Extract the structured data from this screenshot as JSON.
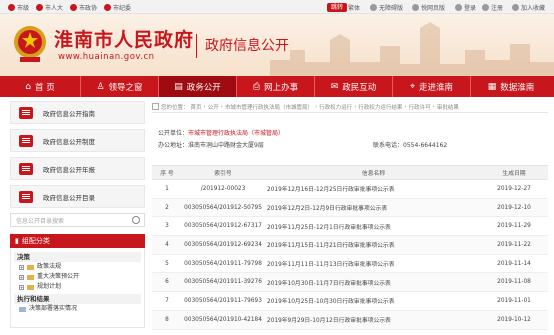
{
  "topbar": {
    "items": [
      "市级",
      "市人大",
      "市政协",
      "市纪委"
    ],
    "jump_label": "跳转",
    "links": [
      "繁体",
      "无障碍版",
      "悦网页版",
      "登录",
      "注册",
      "加入收藏"
    ]
  },
  "header": {
    "site_name": "淮南市人民政府",
    "site_url": "www.huainan.gov.cn",
    "section_title": "政府信息公开"
  },
  "nav": {
    "items": [
      {
        "icon": "home-icon",
        "label": "首 页",
        "glyph": "⌂"
      },
      {
        "icon": "leader-icon",
        "label": "领导之窗",
        "glyph": "♙"
      },
      {
        "icon": "policy-icon",
        "label": "政务公开",
        "glyph": "▤"
      },
      {
        "icon": "online-service-icon",
        "label": "网上办事",
        "glyph": "⎙"
      },
      {
        "icon": "interaction-icon",
        "label": "政民互动",
        "glyph": "✉"
      },
      {
        "icon": "city-icon",
        "label": "走进淮南",
        "glyph": "⌖"
      },
      {
        "icon": "data-icon",
        "label": "数据淮南",
        "glyph": "▦"
      }
    ],
    "active_index": 2
  },
  "sidebar": {
    "buttons": [
      "政府信息公开指南",
      "政府信息公开制度",
      "政府信息公开年报",
      "政府信息公开目录"
    ],
    "search_placeholder": "信息公开目录搜索",
    "tree_title": "组配分类",
    "categories": [
      {
        "label": "决策",
        "items": [
          "政策法规",
          "重大决策预公开",
          "规划计划"
        ]
      },
      {
        "label": "执行和结果",
        "items": [
          "决策部署落实情况"
        ]
      }
    ]
  },
  "breadcrumb": {
    "items": [
      "您的位置：",
      "首页",
      "公开",
      "市城市管理行政执法局（市城管局）",
      "行政权力运行",
      "行政权力运行结果",
      "行政许可",
      "审批结果"
    ]
  },
  "publisher": {
    "unit_label": "公开单位：",
    "unit_value": "市城市管理行政执法局（市城管局）",
    "address_label": "办公地址：",
    "address_value": "淮南市洞山中路财金大厦9层",
    "phone_label": "联系电话：",
    "phone_value": "0554-6644162"
  },
  "table": {
    "headers": [
      "序 号",
      "索引号",
      "信息名称",
      "生成日期"
    ],
    "rows": [
      [
        "1",
        "/201912-00023",
        "2019年12月16日-12月25日行政审批事项公示表",
        "2019-12-27"
      ],
      [
        "2",
        "003050564/201912-50795",
        "2019年12月2日-12月9日行政审批事项公示表",
        "2019-12-10"
      ],
      [
        "3",
        "003050564/201912-67317",
        "2019年11月25日-12月1日行政审批事项公示表",
        "2019-11-29"
      ],
      [
        "4",
        "003050564/201912-69234",
        "2019年11月15日-11月21日行政审批事项公示表",
        "2019-11-22"
      ],
      [
        "5",
        "003050564/201911-79798",
        "2019年11月11日-11月13日行政审批事项公示表",
        "2019-11-14"
      ],
      [
        "6",
        "003050564/201911-39276",
        "2019年10月30日-11月7日行政审批事项公示表",
        "2019-11-08"
      ],
      [
        "7",
        "003050564/201911-79693",
        "2019年10月25日-10月30日行政审批事项公示表",
        "2019-11-01"
      ],
      [
        "8",
        "003050564/201910-42184",
        "2019年9月29日-10月12日行政审批事项公示表",
        "2019-10-12"
      ]
    ]
  },
  "colors": {
    "brand": "#c8161d",
    "nav_active": "#9e0b11"
  }
}
